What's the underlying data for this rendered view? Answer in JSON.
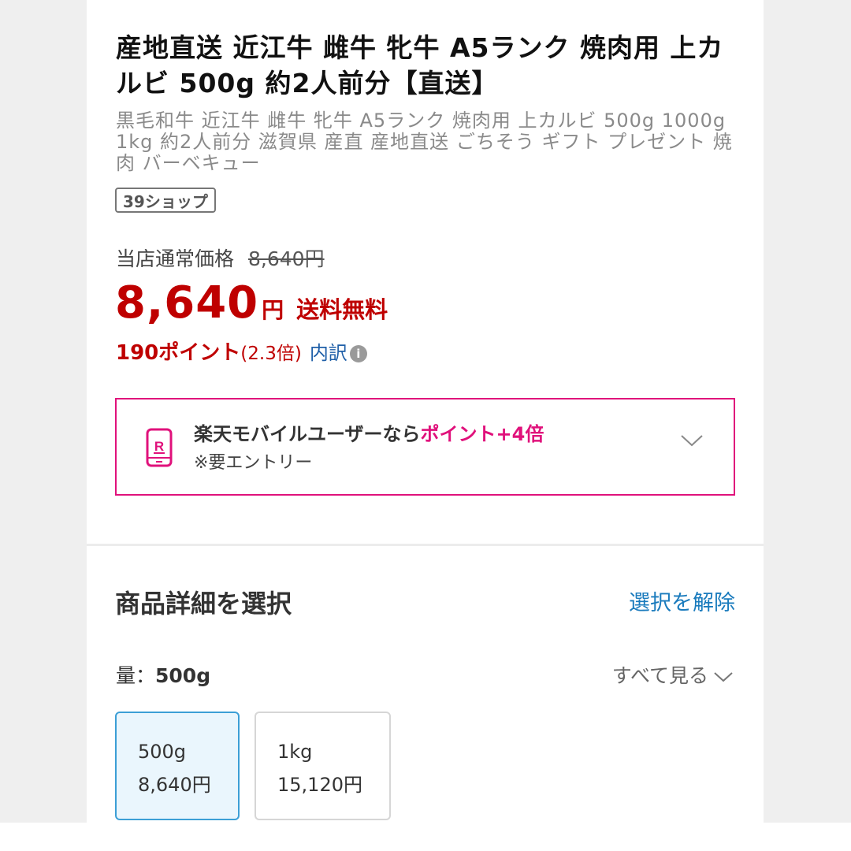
{
  "product": {
    "title": "産地直送 近江牛 雌牛 牝牛 A5ランク 焼肉用 上カルビ 500g 約2人前分【直送】",
    "subtitle": "黒毛和牛 近江牛 雌牛 牝牛 A5ランク 焼肉用 上カルビ 500g 1000g 1kg 約2人前分 滋賀県 産直 産地直送 ごちそう ギフト プレゼント 焼肉 バーベキュー",
    "shop_badge": "39ショップ"
  },
  "price": {
    "regular_label": "当店通常価格",
    "regular_value": "8,640円",
    "sale_value": "8,640",
    "yen": "円",
    "shipping": "送料無料",
    "points": "190ポイント",
    "points_multiplier": "(2.3倍)",
    "breakdown_link": "内訳",
    "info_icon": "i"
  },
  "mobile_promo": {
    "text": "楽天モバイルユーザーなら",
    "highlight": "ポイント+4倍",
    "note": "※要エントリー",
    "icon": "rakuten-mobile-phone-icon",
    "accent_color": "#e0117b"
  },
  "detail_section": {
    "heading": "商品詳細を選択",
    "clear_link": "選択を解除",
    "quantity_label": "量：",
    "quantity_value": "500g",
    "see_all": "すべて見る",
    "options": [
      {
        "name": "500g",
        "price": "8,640円",
        "selected": true
      },
      {
        "name": "1kg",
        "price": "15,120円",
        "selected": false
      }
    ]
  },
  "colors": {
    "price_red": "#bf0000",
    "link_blue": "#1a7bbd",
    "selected_border": "#3c9fd6"
  }
}
